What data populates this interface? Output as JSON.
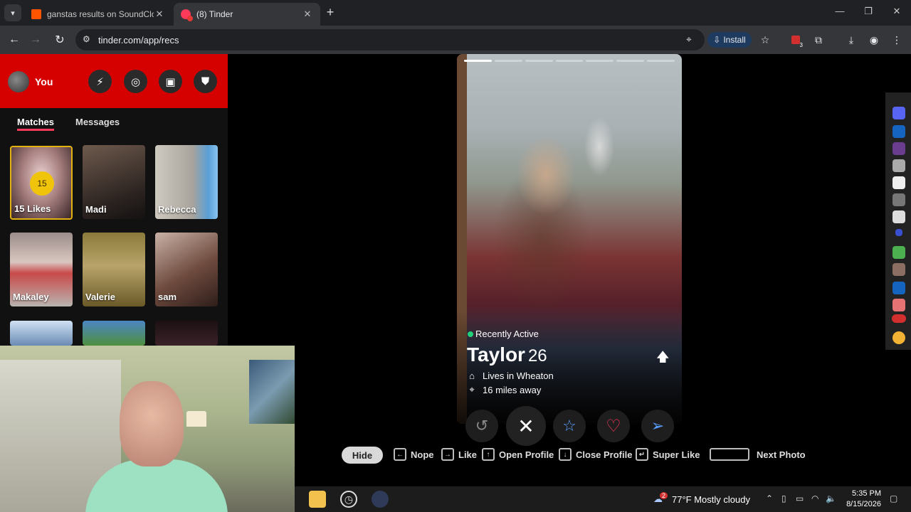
{
  "browser": {
    "tabs": [
      {
        "title": "ganstas results on SoundCloud",
        "active": false
      },
      {
        "title": "(8) Tinder",
        "active": true
      }
    ],
    "url": "tinder.com/app/recs",
    "install_label": "Install",
    "extension_badge": "3"
  },
  "sidebar": {
    "user_label": "You",
    "tabs": {
      "matches": "Matches",
      "messages": "Messages"
    },
    "likes": {
      "count": "15",
      "label": "15 Likes"
    },
    "matches": [
      "Madi",
      "Rebecca",
      "Makaley",
      "Valerie",
      "sam"
    ]
  },
  "profile": {
    "status": "Recently Active",
    "name": "Taylor",
    "age": "26",
    "lives_in": "Lives in Wheaton",
    "distance": "16 miles away",
    "photo_count": 7,
    "photo_index": 1
  },
  "shortcuts": {
    "hide": "Hide",
    "nope": "Nope",
    "like": "Like",
    "open_profile": "Open Profile",
    "close_profile": "Close Profile",
    "super_like": "Super Like",
    "next_photo": "Next Photo"
  },
  "taskbar": {
    "weather_badge": "2",
    "weather": "77°F  Mostly cloudy",
    "time": "5:35 PM",
    "date": "8/15/2026"
  },
  "colors": {
    "accent": "#fd3a5a",
    "header_red": "#d50000",
    "likes_gold": "#f0c40b",
    "online_green": "#21d07a"
  }
}
